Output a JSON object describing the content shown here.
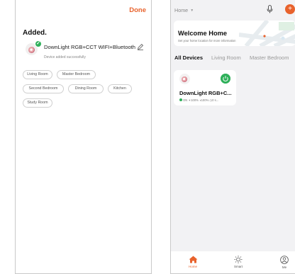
{
  "left_screen": {
    "done_label": "Done",
    "added_title": "Added.",
    "device": {
      "name": "DownLight RGB+CCT WIFI+Bluetooth",
      "status": "Device added successfully",
      "icon": "bulb-icon",
      "badge_icon": "check-icon",
      "edit_icon": "pencil-icon"
    },
    "rooms": [
      "Living Room",
      "Master Bedroom",
      "Second Bedroom",
      "Dining Room",
      "Kitchen",
      "Study Room"
    ]
  },
  "right_screen": {
    "home_selector": "Home",
    "welcome": {
      "title": "Welcome Home",
      "subtitle": "Set your home location for more information"
    },
    "tabs": [
      "All Devices",
      "Living Room",
      "Master Bedroom"
    ],
    "device_card": {
      "name": "DownLight RGB+C...",
      "status": "ON  ☀100%  ◑100%  ◷0 s..."
    },
    "nav": [
      {
        "label": "Home",
        "icon": "home-icon"
      },
      {
        "label": "Smart",
        "icon": "sun-icon"
      },
      {
        "label": "Me",
        "icon": "person-icon"
      }
    ]
  },
  "colors": {
    "accent": "#e8622c",
    "success": "#2fb05a",
    "background_right": "#f2f2f4"
  }
}
